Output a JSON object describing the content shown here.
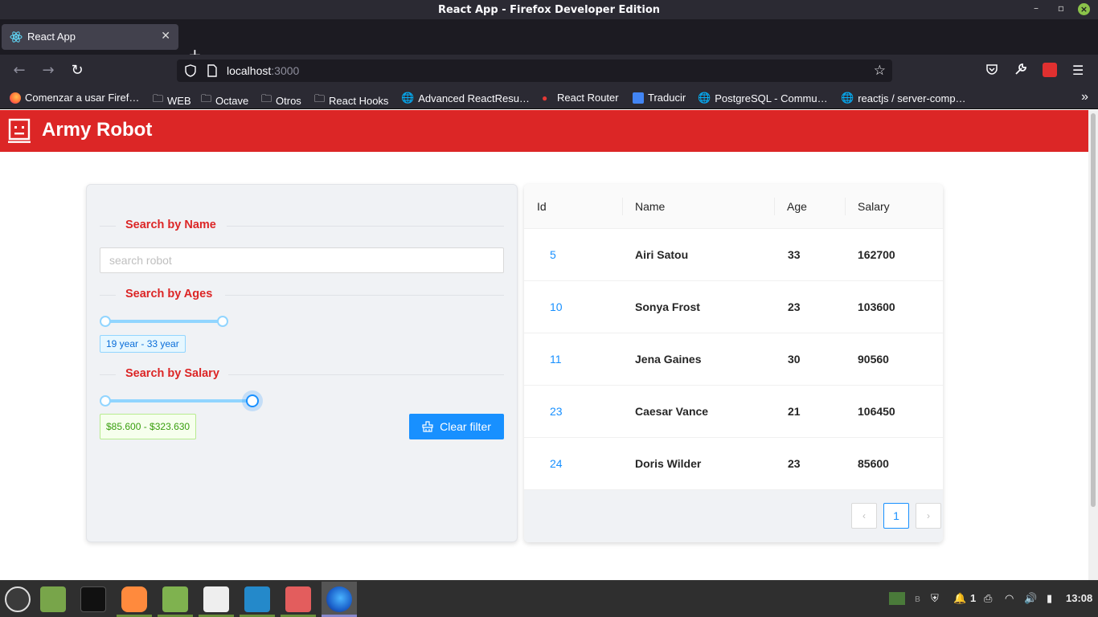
{
  "window": {
    "title": "React App - Firefox Developer Edition"
  },
  "browser": {
    "tab_title": "React App",
    "url_host": "localhost",
    "url_port": ":3000",
    "bookmarks": [
      "Comenzar a usar Firef…",
      "WEB",
      "Octave",
      "Otros",
      "React Hooks",
      "Advanced ReactResu…",
      "React Router",
      "Traducir",
      "PostgreSQL - Commu…",
      "reactjs / server-comp…"
    ]
  },
  "app": {
    "title": "Army Robot",
    "brand_color": "#dc2626"
  },
  "filters": {
    "name_heading": "Search by Name",
    "name_placeholder": "search robot",
    "name_value": "",
    "age_heading": "Search by Ages",
    "age_tag": "19 year - 33 year",
    "age_range": [
      19,
      33
    ],
    "salary_heading": "Search by Salary",
    "salary_tag": "$85.600 - $323.630",
    "salary_range": [
      85600,
      323630
    ],
    "clear_label": "Clear filter"
  },
  "table": {
    "headers": {
      "id": "Id",
      "name": "Name",
      "age": "Age",
      "salary": "Salary"
    },
    "rows": [
      {
        "id": "5",
        "name": "Airi Satou",
        "age": "33",
        "salary": "162700"
      },
      {
        "id": "10",
        "name": "Sonya Frost",
        "age": "23",
        "salary": "103600"
      },
      {
        "id": "11",
        "name": "Jena Gaines",
        "age": "30",
        "salary": "90560"
      },
      {
        "id": "23",
        "name": "Caesar Vance",
        "age": "21",
        "salary": "106450"
      },
      {
        "id": "24",
        "name": "Doris Wilder",
        "age": "23",
        "salary": "85600"
      }
    ],
    "pagination": {
      "prev": "‹",
      "current_page": "1",
      "next": "›"
    }
  },
  "taskbar": {
    "notifications": "1",
    "clock": "13:08"
  }
}
